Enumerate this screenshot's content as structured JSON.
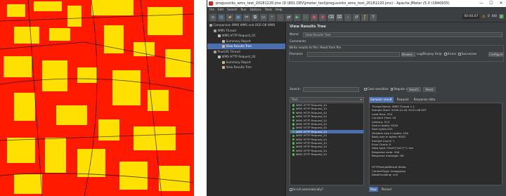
{
  "window": {
    "title": "proguvorks_wms_test_20181220.jmx (D:\\801.DEV\\jmeter_test\\proguvorks_wms_test_20181220.jmx) - Apache JMeter (5.0 r1840935)",
    "minimize": "—",
    "maximize": "☐",
    "close": "✕"
  },
  "menu": [
    "File",
    "Edit",
    "Search",
    "Run",
    "Options",
    "Tools",
    "Help"
  ],
  "toolbar": {
    "timer": "00:00:07",
    "warnings": "0",
    "threads": "0/0"
  },
  "tree": [
    {
      "label": "Comparison WMS WMS and OGR OB WMS",
      "indent": 0,
      "icon": "#9aa7b5"
    },
    {
      "label": "WMS Thread",
      "indent": 1,
      "icon": "#a0a0a0"
    },
    {
      "label": "WMS HTTP Request_01",
      "indent": 2,
      "icon": "#c0c0c0"
    },
    {
      "label": "Summary Report",
      "indent": 3,
      "icon": "#d2b48c"
    },
    {
      "label": "View Results Tree",
      "indent": 3,
      "icon": "#d2b48c",
      "selected": true
    },
    {
      "label": "ProxGIS Thread",
      "indent": 1,
      "icon": "#a0a0a0"
    },
    {
      "label": "WMS HTTP Request_02",
      "indent": 2,
      "icon": "#c0c0c0"
    },
    {
      "label": "Summary Report",
      "indent": 3,
      "icon": "#d2b48c"
    },
    {
      "label": "View Results Tree",
      "indent": 3,
      "icon": "#d2b48c"
    }
  ],
  "panel": {
    "title": "View Results Tree",
    "name_label": "Name:",
    "name_value": "View Results Tree",
    "comments_label": "Comments:",
    "write_label": "Write results to file / Read from file",
    "filename_label": "Filename",
    "browse": "Browse...",
    "log_display": "Log/Display Only:",
    "errors": "Errors",
    "successes": "Successes",
    "configure": "Configure",
    "search_label": "Search:",
    "case_sensitive": "Case sensitive",
    "regular_exp": "Regular exp.",
    "search_btn": "Search",
    "reset_btn": "Reset",
    "renderer": "Text",
    "tabs": [
      "Sampler result",
      "Request",
      "Response data"
    ],
    "bottom_tabs": [
      "Raw",
      "Parsed"
    ],
    "scroll": "Scroll automatically?"
  },
  "samples": [
    "WMS HTTP Request_01",
    "WMS HTTP Request_01",
    "WMS HTTP Request_01",
    "WMS HTTP Request_01",
    "WMS HTTP Request_01",
    "WMS HTTP Request_01",
    "WMS HTTP Request_01",
    "WMS HTTP Request_01",
    "WMS HTTP Request_01",
    "WMS HTTP Request_01",
    "WMS HTTP Request_01",
    "WMS HTTP Request_01",
    "WMS HTTP Request_01",
    "WMS HTTP Request_01"
  ],
  "result_lines": [
    "Thread Name: WMS Thread 1-1",
    "Sample Start: 2018-12-20 10:21:08 KST",
    "Load time: 515",
    "Connect Time: 10",
    "Latency: 514",
    "Size in bytes: 9290",
    "Sent bytes:253",
    "Headers size in bytes: 226",
    "Body size in bytes: 9020",
    "Sample Count: 1",
    "Error Count: 0",
    "Data type (\"text\"|\"bin\"|\"\"): bin",
    "Response code: 200",
    "Response message: OK",
    "",
    "",
    "HTTPSampleResult fields:",
    "ContentType: image/png",
    "DataEncoding: null"
  ]
}
